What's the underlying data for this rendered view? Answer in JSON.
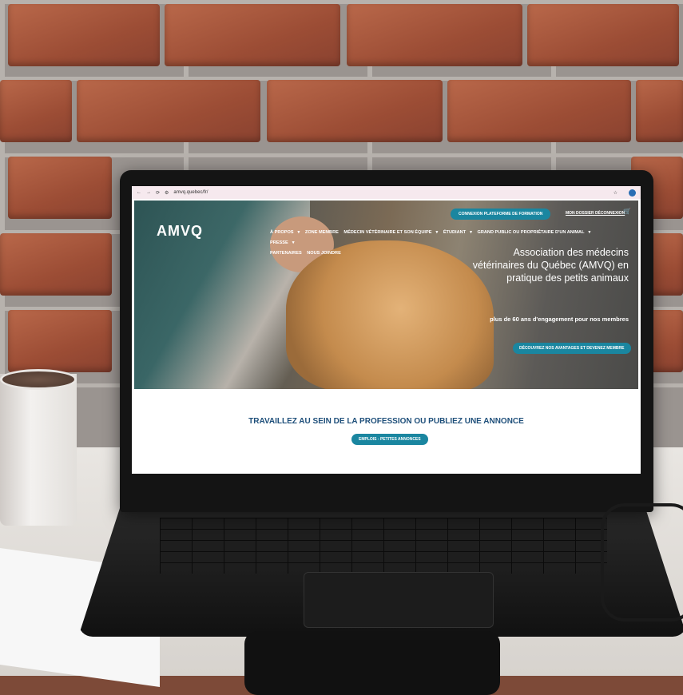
{
  "browser": {
    "url": "amvq.quebec/fr/"
  },
  "header": {
    "logo": "AMVQ",
    "training_button": "CONNEXION PLATEFORME DE FORMATION",
    "account_links": "MON DOSSIER DÉCONNEXION"
  },
  "nav": {
    "items": [
      "À PROPOS",
      "ZONE MEMBRE",
      "MÉDECIN VÉTÉRINAIRE ET SON ÉQUIPE",
      "ÉTUDIANT",
      "GRAND PUBLIC OU PROPRIÉTAIRE D'UN ANIMAL",
      "PRESSE",
      "PARTENAIRES",
      "NOUS JOINDRE"
    ]
  },
  "hero": {
    "title": "Association des médecins vétérinaires du Québec (AMVQ) en pratique des petits animaux",
    "subtitle": "plus de 60 ans d'engagement pour nos membres",
    "cta": "DÉCOUVREZ NOS AVANTAGES ET DEVENEZ MEMBRE"
  },
  "jobs": {
    "title": "TRAVAILLEZ AU SEIN DE LA PROFESSION OU PUBLIEZ UNE ANNONCE",
    "button": "EMPLOIS - PETITES ANNONCES"
  },
  "colors": {
    "accent": "#1a86a0",
    "heading": "#1e4f7a"
  }
}
